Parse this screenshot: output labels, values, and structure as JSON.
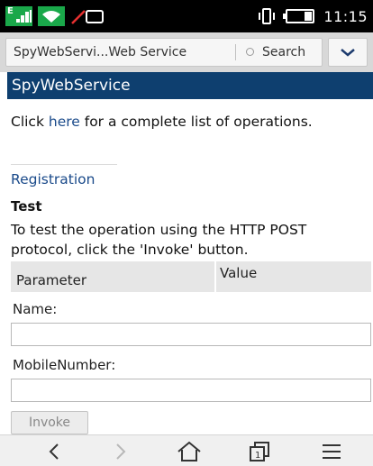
{
  "status_bar": {
    "network_type": "E",
    "time": "11:15"
  },
  "browser": {
    "tab_title": "SpyWebServi...Web Service",
    "search_label": "Search"
  },
  "page": {
    "header": "SpyWebService",
    "intro_prefix": "Click ",
    "intro_link": "here",
    "intro_suffix": " for a complete list of operations.",
    "operation_link": "Registration",
    "test_heading": "Test",
    "test_description": "To test the operation using the HTTP POST protocol, click the 'Invoke' button.",
    "table": {
      "col_parameter": "Parameter",
      "col_value": "Value"
    },
    "fields": [
      {
        "label": "Name:",
        "value": ""
      },
      {
        "label": "MobileNumber:",
        "value": ""
      }
    ],
    "invoke_label": "Invoke"
  },
  "nav": {
    "icons": [
      "back-arrow-icon",
      "forward-arrow-icon",
      "home-icon",
      "tabs-icon",
      "menu-icon"
    ],
    "tabs_count": "1"
  },
  "colors": {
    "header_bg": "#0e3f6f",
    "link": "#1a4a8a",
    "status_green": "#1aa84a"
  }
}
